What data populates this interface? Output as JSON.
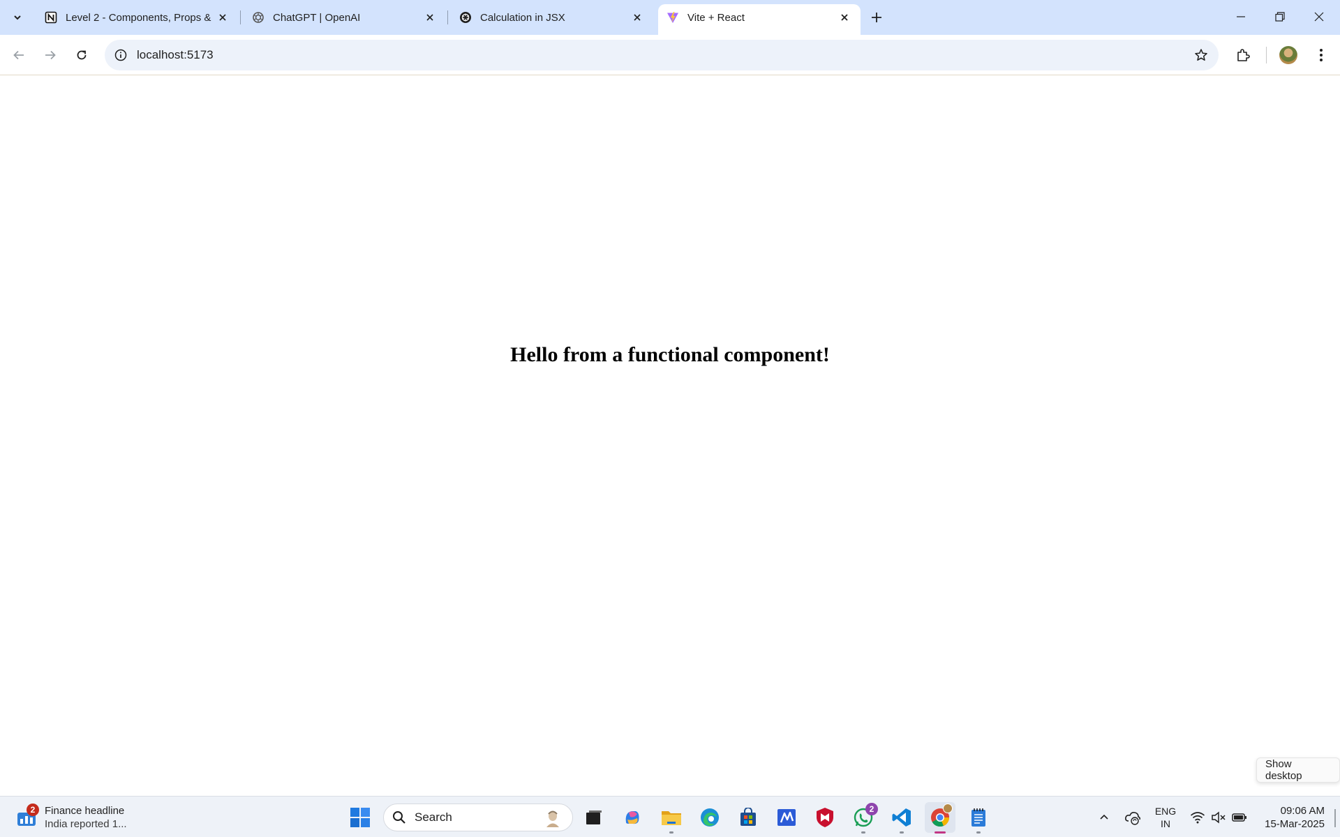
{
  "browser": {
    "tabs": [
      {
        "title": "Level 2 - Components, Props &",
        "favicon": "notion-icon",
        "active": false
      },
      {
        "title": "ChatGPT | OpenAI",
        "favicon": "openai-icon",
        "active": false
      },
      {
        "title": "Calculation in JSX",
        "favicon": "openai-icon",
        "active": false
      },
      {
        "title": "Vite + React",
        "favicon": "vite-icon",
        "active": true
      }
    ],
    "address": "localhost:5173"
  },
  "page": {
    "heading": "Hello from a functional component!"
  },
  "tooltip": "Show desktop",
  "taskbar": {
    "widget": {
      "title": "Finance headline",
      "subtitle": "India reported 1...",
      "badge": "2"
    },
    "search_label": "Search",
    "whatsapp_badge": "2",
    "lang_top": "ENG",
    "lang_bottom": "IN",
    "time": "09:06 AM",
    "date": "15-Mar-2025"
  },
  "colors": {
    "tabstrip": "#d3e3fd",
    "omnibox": "#edf2fa",
    "taskbar": "#eef2f8",
    "badge_red": "#c42b1c",
    "badge_purple": "#8e44ad"
  }
}
